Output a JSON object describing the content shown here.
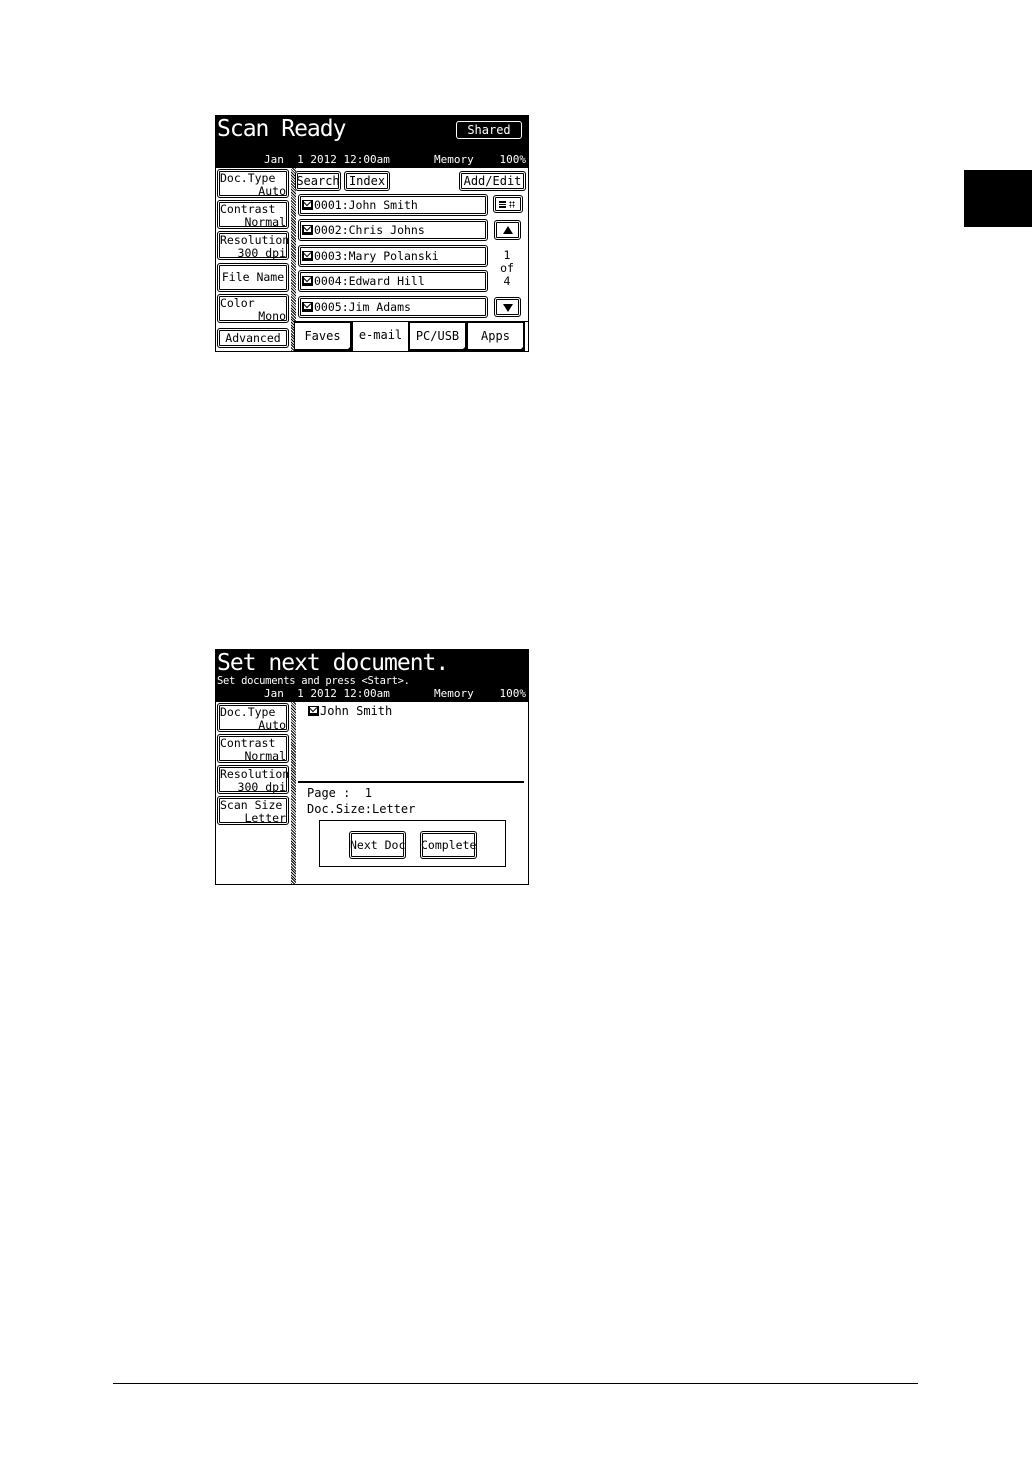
{
  "scan_ready": {
    "title": "Scan Ready",
    "shared_label": "Shared",
    "status": {
      "datetime": "Jan  1 2012 12:00am",
      "memory_label": "Memory",
      "memory_value": "100%"
    },
    "settings": [
      {
        "label": "Doc.Type",
        "value": "Auto"
      },
      {
        "label": "Contrast",
        "value": "Normal"
      },
      {
        "label": "Resolution",
        "value": "300 dpi"
      },
      {
        "label": "File Name",
        "value": ""
      },
      {
        "label": "Color",
        "value": "Mono"
      }
    ],
    "advanced_label": "Advanced",
    "search_label": "Search",
    "index_label": "Index",
    "add_edit_label": "Add/Edit",
    "contacts": [
      "0001:John Smith",
      "0002:Chris Johns",
      "0003:Mary Polanski",
      "0004:Edward Hill",
      "0005:Jim Adams"
    ],
    "pager": {
      "current": "1",
      "of": "of",
      "total": "4"
    },
    "tabs": [
      "Faves",
      "e-mail",
      "PC/USB",
      "Apps"
    ],
    "selected_tab": "e-mail"
  },
  "next_doc": {
    "title": "Set next document.",
    "subtitle": "Set documents and press <Start>.",
    "status": {
      "datetime": "Jan  1 2012 12:00am",
      "memory_label": "Memory",
      "memory_value": "100%"
    },
    "settings": [
      {
        "label": "Doc.Type",
        "value": "Auto"
      },
      {
        "label": "Contrast",
        "value": "Normal"
      },
      {
        "label": "Resolution",
        "value": "300 dpi"
      },
      {
        "label": "Scan Size",
        "value": "Letter"
      }
    ],
    "recipient": "John Smith",
    "page_line": "Page :  1",
    "doc_size_line": "Doc.Size:Letter",
    "next_doc_label": "Next Doc",
    "complete_label": "Complete"
  }
}
